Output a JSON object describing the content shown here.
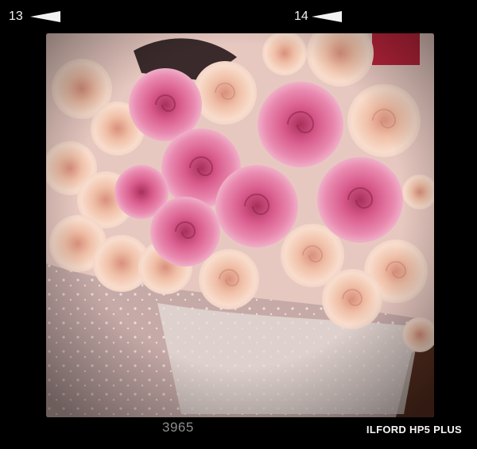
{
  "film_strip": {
    "frame_left": "13",
    "frame_right": "14",
    "code": "3965",
    "film_name": "ILFORD HP5 PLUS"
  },
  "photo": {
    "icon": "roses-bouquet-photo",
    "colors": {
      "pink_rose": "#e06a9a",
      "peach_rose": "#f4cdb8",
      "tulle": "#c9b2b0",
      "wood": "#5a3020"
    }
  }
}
